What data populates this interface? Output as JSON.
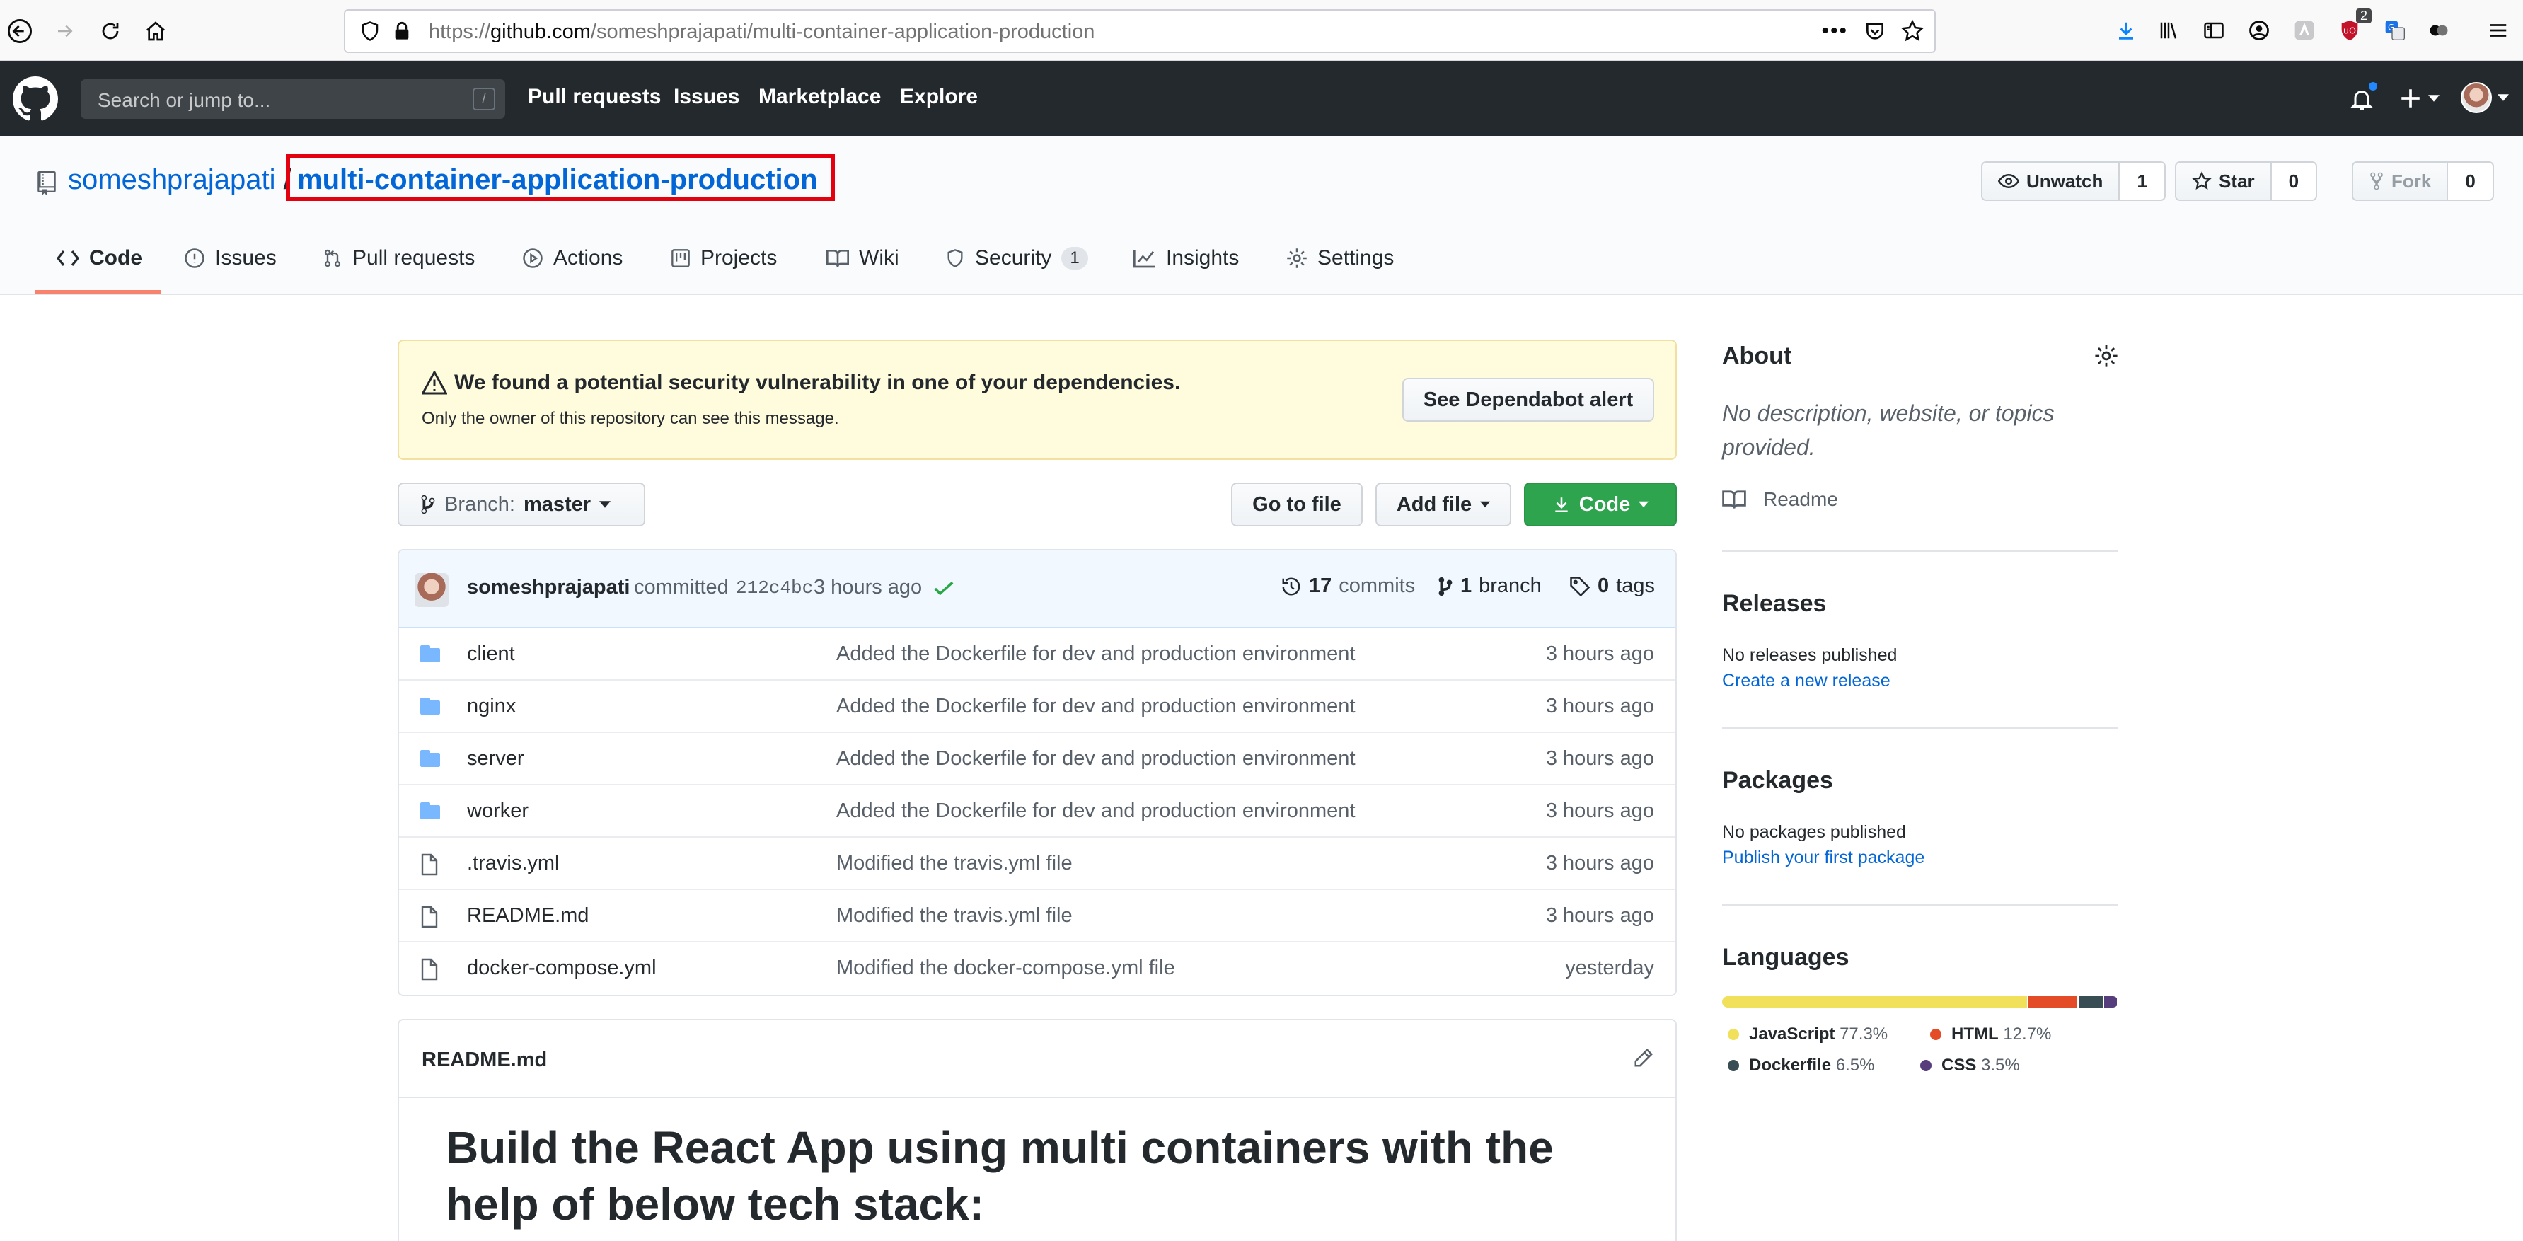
{
  "browser": {
    "url_prefix": "https://",
    "url_host": "github.com",
    "url_path": "/someshprajapati/multi-container-application-production",
    "ext_badge": "2"
  },
  "header": {
    "search_placeholder": "Search or jump to...",
    "search_shortcut": "/",
    "nav": [
      "Pull requests",
      "Issues",
      "Marketplace",
      "Explore"
    ]
  },
  "repo": {
    "owner": "someshprajapati",
    "separator": "/",
    "name": "multi-container-application-production",
    "watch_label": "Unwatch",
    "watch_count": "1",
    "star_label": "Star",
    "star_count": "0",
    "fork_label": "Fork",
    "fork_count": "0"
  },
  "tabs": [
    {
      "label": "Code",
      "icon": "code-icon"
    },
    {
      "label": "Issues",
      "icon": "issue-icon"
    },
    {
      "label": "Pull requests",
      "icon": "pull-request-icon"
    },
    {
      "label": "Actions",
      "icon": "play-icon"
    },
    {
      "label": "Projects",
      "icon": "project-icon"
    },
    {
      "label": "Wiki",
      "icon": "book-icon"
    },
    {
      "label": "Security",
      "icon": "shield-icon",
      "counter": "1"
    },
    {
      "label": "Insights",
      "icon": "graph-icon"
    },
    {
      "label": "Settings",
      "icon": "gear-icon"
    }
  ],
  "alert": {
    "title": "We found a potential security vulnerability in one of your dependencies.",
    "subtitle": "Only the owner of this repository can see this message.",
    "button": "See Dependabot alert"
  },
  "toolbar": {
    "branch_label": "Branch:",
    "branch_name": "master",
    "go_to_file": "Go to file",
    "add_file": "Add file",
    "code": "Code"
  },
  "commit": {
    "author": "someshprajapati",
    "verb": "committed",
    "sha": "212c4bc",
    "time": "3 hours ago",
    "commits_count": "17",
    "commits_label": "commits",
    "branch_count": "1",
    "branch_label": "branch",
    "tags_count": "0",
    "tags_label": "tags"
  },
  "files": [
    {
      "type": "dir",
      "name": "client",
      "message": "Added the Dockerfile for dev and production environment",
      "age": "3 hours ago"
    },
    {
      "type": "dir",
      "name": "nginx",
      "message": "Added the Dockerfile for dev and production environment",
      "age": "3 hours ago"
    },
    {
      "type": "dir",
      "name": "server",
      "message": "Added the Dockerfile for dev and production environment",
      "age": "3 hours ago"
    },
    {
      "type": "dir",
      "name": "worker",
      "message": "Added the Dockerfile for dev and production environment",
      "age": "3 hours ago"
    },
    {
      "type": "file",
      "name": ".travis.yml",
      "message": "Modified the travis.yml file",
      "age": "3 hours ago"
    },
    {
      "type": "file",
      "name": "README.md",
      "message": "Modified the travis.yml file",
      "age": "3 hours ago"
    },
    {
      "type": "file",
      "name": "docker-compose.yml",
      "message": "Modified the docker-compose.yml file",
      "age": "yesterday"
    }
  ],
  "readme": {
    "filename": "README.md",
    "heading": "Build the React App using multi containers with the help of below tech stack:"
  },
  "sidebar": {
    "about_title": "About",
    "about_desc": "No description, website, or topics provided.",
    "readme_label": "Readme",
    "releases_title": "Releases",
    "releases_text": "No releases published",
    "releases_link": "Create a new release",
    "packages_title": "Packages",
    "packages_text": "No packages published",
    "packages_link": "Publish your first package",
    "languages_title": "Languages",
    "languages": [
      {
        "name": "JavaScript",
        "percent": "77.3%",
        "value": 77.3,
        "color": "#f1e05a"
      },
      {
        "name": "HTML",
        "percent": "12.7%",
        "value": 12.7,
        "color": "#e34c26"
      },
      {
        "name": "Dockerfile",
        "percent": "6.5%",
        "value": 6.5,
        "color": "#384d54"
      },
      {
        "name": "CSS",
        "percent": "3.5%",
        "value": 3.5,
        "color": "#563d7c"
      }
    ]
  }
}
